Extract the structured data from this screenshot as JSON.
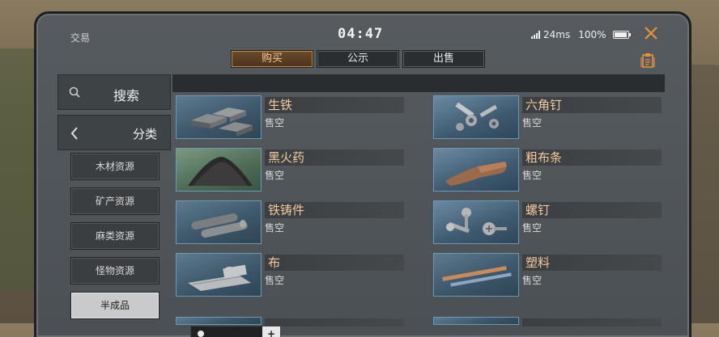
{
  "header": {
    "title": "交易",
    "clock": "04:47",
    "ping": "24ms",
    "battery": "100%"
  },
  "tabs": [
    {
      "label": "购买",
      "active": true
    },
    {
      "label": "公示",
      "active": false
    },
    {
      "label": "出售",
      "active": false
    }
  ],
  "sidebar": {
    "search_label": "搜索",
    "category_label": "分类",
    "subcategories": [
      {
        "label": "木材资源",
        "active": false
      },
      {
        "label": "矿产资源",
        "active": false
      },
      {
        "label": "麻类资源",
        "active": false
      },
      {
        "label": "怪物资源",
        "active": false
      },
      {
        "label": "半成品",
        "active": true
      }
    ]
  },
  "items": [
    {
      "name": "生铁",
      "status": "售空",
      "icon": "pig-iron-icon"
    },
    {
      "name": "六角钉",
      "status": "售空",
      "icon": "hex-nail-icon"
    },
    {
      "name": "黑火药",
      "status": "售空",
      "icon": "gunpowder-icon"
    },
    {
      "name": "粗布条",
      "status": "售空",
      "icon": "cloth-strip-icon"
    },
    {
      "name": "铁铸件",
      "status": "售空",
      "icon": "iron-casting-icon"
    },
    {
      "name": "螺钉",
      "status": "售空",
      "icon": "screw-icon"
    },
    {
      "name": "布",
      "status": "售空",
      "icon": "cloth-roll-icon"
    },
    {
      "name": "塑料",
      "status": "售空",
      "icon": "plastic-rod-icon"
    }
  ],
  "colors": {
    "accent": "#e8913a",
    "item_name": "#f4c9a0",
    "active_sub": "#c9cacb"
  }
}
